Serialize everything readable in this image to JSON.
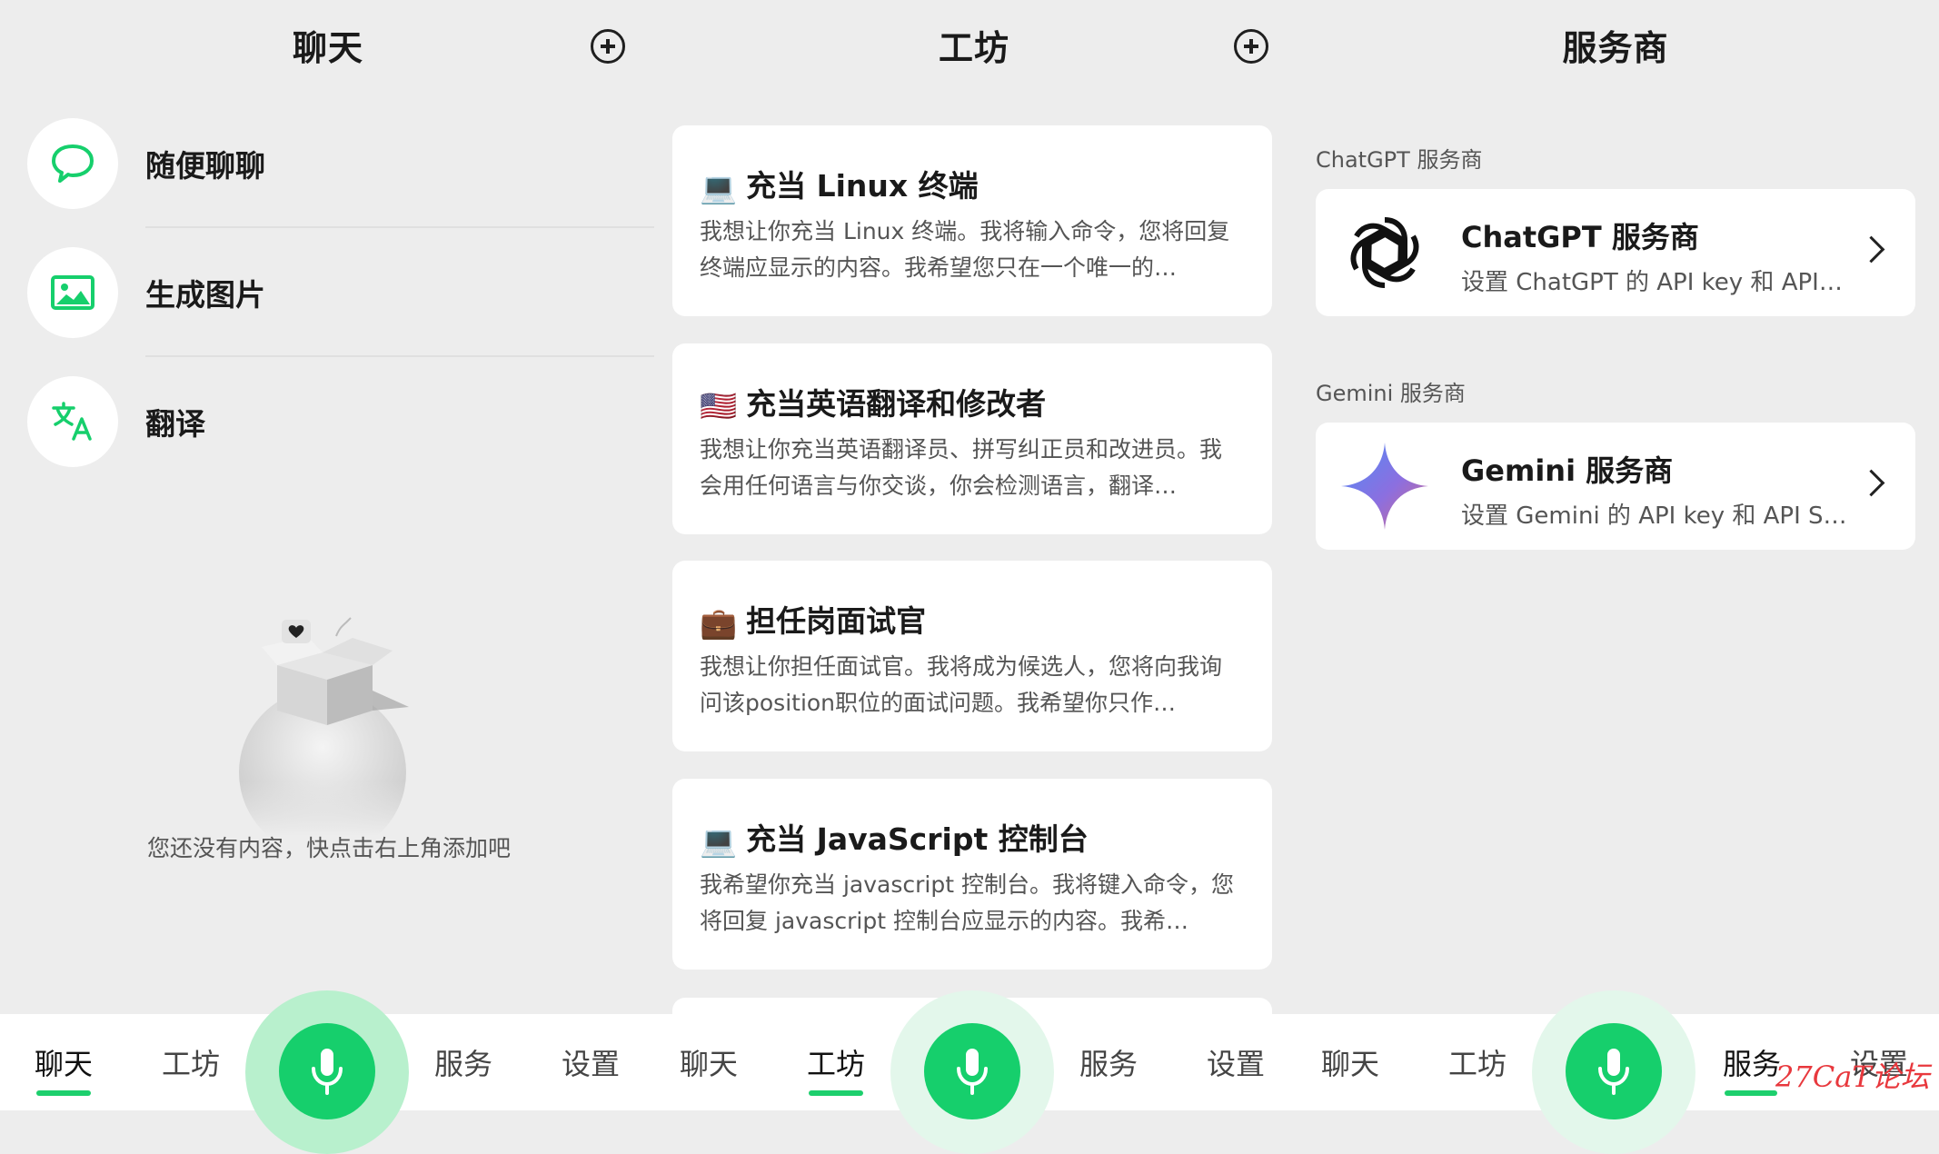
{
  "chat_panel": {
    "title": "聊天",
    "items": [
      {
        "label": "随便聊聊",
        "icon": "chat-bubble-icon"
      },
      {
        "label": "生成图片",
        "icon": "image-icon"
      },
      {
        "label": "翻译",
        "icon": "translate-icon"
      }
    ],
    "empty_text": "您还没有内容，快点击右上角添加吧"
  },
  "workshop_panel": {
    "title": "工坊",
    "cards": [
      {
        "emoji": "💻",
        "title": "充当 Linux 终端",
        "desc": "我想让你充当 Linux 终端。我将输入命令，您将回复终端应显示的内容。我希望您只在一个唯一的…"
      },
      {
        "emoji": "🇺🇸",
        "title": "充当英语翻译和修改者",
        "desc": "我想让你充当英语翻译员、拼写纠正员和改进员。我会用任何语言与你交谈，你会检测语言，翻译…"
      },
      {
        "emoji": "💼",
        "title": "担任岗面试官",
        "desc": "我想让你担任面试官。我将成为候选人，您将向我询问该position职位的面试问题。我希望你只作…"
      },
      {
        "emoji": "💻",
        "title": "充当 JavaScript 控制台",
        "desc": "我希望你充当 javascript 控制台。我将键入命令，您将回复 javascript 控制台应显示的内容。我希…"
      }
    ]
  },
  "provider_panel": {
    "title": "服务商",
    "sections": [
      {
        "label": "ChatGPT 服务商",
        "card_title": "ChatGPT 服务商",
        "card_sub": "设置 ChatGPT 的 API key 和 API…",
        "icon": "openai-logo-icon"
      },
      {
        "label": "Gemini 服务商",
        "card_title": "Gemini 服务商",
        "card_sub": "设置 Gemini 的 API key 和 API S…",
        "icon": "gemini-sparkle-icon"
      }
    ]
  },
  "nav": {
    "chat": "聊天",
    "workshop": "工坊",
    "services": "服务",
    "settings": "设置"
  },
  "watermark": "27CaT论坛",
  "colors": {
    "accent": "#16cf6c",
    "background": "#ededed"
  }
}
